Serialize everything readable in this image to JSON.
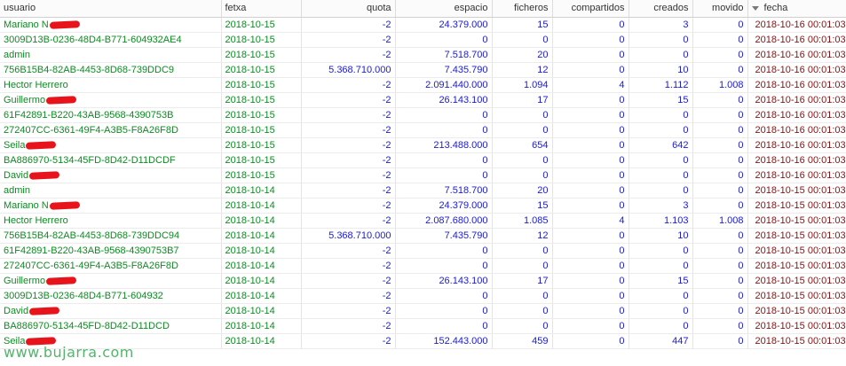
{
  "columns": [
    "usuario",
    "fetxa",
    "quota",
    "espacio",
    "ficheros",
    "compartidos",
    "creados",
    "movido",
    "fecha"
  ],
  "rows": [
    {
      "usuario": "Mariano N",
      "redacted": true,
      "fetxa": "2018-10-15",
      "quota": "-2",
      "espacio": "24.379.000",
      "ficheros": "15",
      "compartidos": "0",
      "creados": "3",
      "movido": "0",
      "fecha": "2018-10-16 00:01:03"
    },
    {
      "usuario": "3009D13B-0236-48D4-B771-604932AE4",
      "redacted": false,
      "fetxa": "2018-10-15",
      "quota": "-2",
      "espacio": "0",
      "ficheros": "0",
      "compartidos": "0",
      "creados": "0",
      "movido": "0",
      "fecha": "2018-10-16 00:01:03"
    },
    {
      "usuario": "admin",
      "redacted": false,
      "fetxa": "2018-10-15",
      "quota": "-2",
      "espacio": "7.518.700",
      "ficheros": "20",
      "compartidos": "0",
      "creados": "0",
      "movido": "0",
      "fecha": "2018-10-16 00:01:03"
    },
    {
      "usuario": "756B15B4-82AB-4453-8D68-739DDC9",
      "redacted": false,
      "fetxa": "2018-10-15",
      "quota": "5.368.710.000",
      "espacio": "7.435.790",
      "ficheros": "12",
      "compartidos": "0",
      "creados": "10",
      "movido": "0",
      "fecha": "2018-10-16 00:01:03"
    },
    {
      "usuario": "Hector Herrero",
      "redacted": false,
      "fetxa": "2018-10-15",
      "quota": "-2",
      "espacio": "2.091.440.000",
      "ficheros": "1.094",
      "compartidos": "4",
      "creados": "1.112",
      "movido": "1.008",
      "fecha": "2018-10-16 00:01:03"
    },
    {
      "usuario": "Guillermo",
      "redacted": true,
      "fetxa": "2018-10-15",
      "quota": "-2",
      "espacio": "26.143.100",
      "ficheros": "17",
      "compartidos": "0",
      "creados": "15",
      "movido": "0",
      "fecha": "2018-10-16 00:01:03"
    },
    {
      "usuario": "61F42891-B220-43AB-9568-4390753B",
      "redacted": false,
      "fetxa": "2018-10-15",
      "quota": "-2",
      "espacio": "0",
      "ficheros": "0",
      "compartidos": "0",
      "creados": "0",
      "movido": "0",
      "fecha": "2018-10-16 00:01:03"
    },
    {
      "usuario": "272407CC-6361-49F4-A3B5-F8A26F8D",
      "redacted": false,
      "fetxa": "2018-10-15",
      "quota": "-2",
      "espacio": "0",
      "ficheros": "0",
      "compartidos": "0",
      "creados": "0",
      "movido": "0",
      "fecha": "2018-10-16 00:01:03"
    },
    {
      "usuario": "Seila",
      "redacted": true,
      "fetxa": "2018-10-15",
      "quota": "-2",
      "espacio": "213.488.000",
      "ficheros": "654",
      "compartidos": "0",
      "creados": "642",
      "movido": "0",
      "fecha": "2018-10-16 00:01:03"
    },
    {
      "usuario": "BA886970-5134-45FD-8D42-D11DCDF",
      "redacted": false,
      "fetxa": "2018-10-15",
      "quota": "-2",
      "espacio": "0",
      "ficheros": "0",
      "compartidos": "0",
      "creados": "0",
      "movido": "0",
      "fecha": "2018-10-16 00:01:03"
    },
    {
      "usuario": "David",
      "redacted": true,
      "fetxa": "2018-10-15",
      "quota": "-2",
      "espacio": "0",
      "ficheros": "0",
      "compartidos": "0",
      "creados": "0",
      "movido": "0",
      "fecha": "2018-10-16 00:01:03"
    },
    {
      "usuario": "admin",
      "redacted": false,
      "fetxa": "2018-10-14",
      "quota": "-2",
      "espacio": "7.518.700",
      "ficheros": "20",
      "compartidos": "0",
      "creados": "0",
      "movido": "0",
      "fecha": "2018-10-15 00:01:03"
    },
    {
      "usuario": "Mariano N",
      "redacted": true,
      "fetxa": "2018-10-14",
      "quota": "-2",
      "espacio": "24.379.000",
      "ficheros": "15",
      "compartidos": "0",
      "creados": "3",
      "movido": "0",
      "fecha": "2018-10-15 00:01:03"
    },
    {
      "usuario": "Hector Herrero",
      "redacted": false,
      "fetxa": "2018-10-14",
      "quota": "-2",
      "espacio": "2.087.680.000",
      "ficheros": "1.085",
      "compartidos": "4",
      "creados": "1.103",
      "movido": "1.008",
      "fecha": "2018-10-15 00:01:03"
    },
    {
      "usuario": "756B15B4-82AB-4453-8D68-739DDC94",
      "redacted": false,
      "fetxa": "2018-10-14",
      "quota": "5.368.710.000",
      "espacio": "7.435.790",
      "ficheros": "12",
      "compartidos": "0",
      "creados": "10",
      "movido": "0",
      "fecha": "2018-10-15 00:01:03"
    },
    {
      "usuario": "61F42891-B220-43AB-9568-4390753B7",
      "redacted": false,
      "fetxa": "2018-10-14",
      "quota": "-2",
      "espacio": "0",
      "ficheros": "0",
      "compartidos": "0",
      "creados": "0",
      "movido": "0",
      "fecha": "2018-10-15 00:01:03"
    },
    {
      "usuario": "272407CC-6361-49F4-A3B5-F8A26F8D",
      "redacted": false,
      "fetxa": "2018-10-14",
      "quota": "-2",
      "espacio": "0",
      "ficheros": "0",
      "compartidos": "0",
      "creados": "0",
      "movido": "0",
      "fecha": "2018-10-15 00:01:03"
    },
    {
      "usuario": "Guillermo",
      "redacted": true,
      "fetxa": "2018-10-14",
      "quota": "-2",
      "espacio": "26.143.100",
      "ficheros": "17",
      "compartidos": "0",
      "creados": "15",
      "movido": "0",
      "fecha": "2018-10-15 00:01:03"
    },
    {
      "usuario": "3009D13B-0236-48D4-B771-604932",
      "redacted": false,
      "fetxa": "2018-10-14",
      "quota": "-2",
      "espacio": "0",
      "ficheros": "0",
      "compartidos": "0",
      "creados": "0",
      "movido": "0",
      "fecha": "2018-10-15 00:01:03"
    },
    {
      "usuario": "David",
      "redacted": true,
      "fetxa": "2018-10-14",
      "quota": "-2",
      "espacio": "0",
      "ficheros": "0",
      "compartidos": "0",
      "creados": "0",
      "movido": "0",
      "fecha": "2018-10-15 00:01:03"
    },
    {
      "usuario": "BA886970-5134-45FD-8D42-D11DCD",
      "redacted": false,
      "fetxa": "2018-10-14",
      "quota": "-2",
      "espacio": "0",
      "ficheros": "0",
      "compartidos": "0",
      "creados": "0",
      "movido": "0",
      "fecha": "2018-10-15 00:01:03"
    },
    {
      "usuario": "Seila",
      "redacted": true,
      "fetxa": "2018-10-14",
      "quota": "-2",
      "espacio": "152.443.000",
      "ficheros": "459",
      "compartidos": "0",
      "creados": "447",
      "movido": "0",
      "fecha": "2018-10-15 00:01:03"
    }
  ],
  "watermark": "www.bujarra.com",
  "icons": {
    "sort": "sort-desc-icon"
  },
  "colors": {
    "usuario": "#0e8a22",
    "numbers": "#1a1ad8",
    "fecha": "#8b1010"
  }
}
